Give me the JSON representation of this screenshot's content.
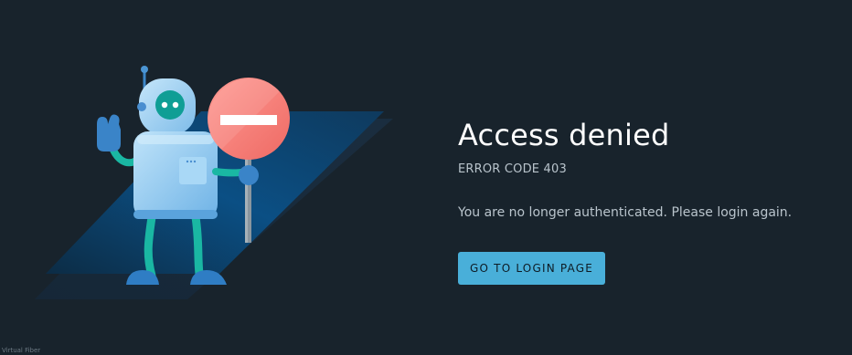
{
  "error": {
    "title": "Access denied",
    "code": "ERROR CODE 403",
    "message": "You are no longer authenticated. Please login again."
  },
  "actions": {
    "login_label": "GO TO LOGIN PAGE"
  },
  "footer": {
    "text": "Virtual Fiber"
  },
  "colors": {
    "background": "#18232c",
    "button": "#49afd9",
    "stop_sign": "#f47a72"
  },
  "icons": {
    "illustration": "robot-with-stop-sign"
  }
}
